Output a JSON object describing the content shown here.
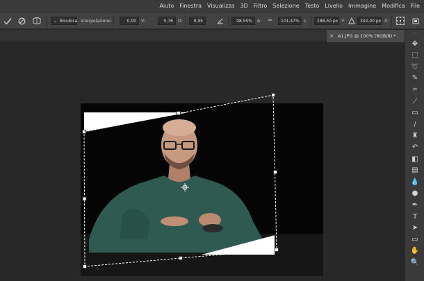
{
  "menu": {
    "items": [
      "File",
      "Modifica",
      "Immagine",
      "Livello",
      "Testo",
      "Selezione",
      "Filtro",
      "3D",
      "Visualizza",
      "Finestra",
      "Aiuto"
    ]
  },
  "options": {
    "x_label": "X:",
    "x_value": "302,00 px",
    "y_label": "Y:",
    "y_value": "188,50 px",
    "l_label": "L:",
    "l_value": "101,47%",
    "a_label": "A:",
    "a_value": "98,55%",
    "angle_value": "9,95",
    "o_label": "O:",
    "o_value": "5,76",
    "v_label": "V:",
    "v_value": "0,00",
    "interp_label": "Interpolazione:",
    "interp_value": "Bicubica"
  },
  "document": {
    "tab_label": "A1.JPG @ 100% (RGB/8) *",
    "close_label": "×"
  },
  "colors": {
    "menubar": "#3a3a3a",
    "optionsbar": "#424242",
    "canvas": "#282828",
    "toolbar": "#3a3a3a",
    "sweater": "#2e5a52"
  },
  "tools": [
    "move-tool-icon",
    "rectangular-marquee-icon",
    "lasso-icon",
    "quick-selection-icon",
    "crop-icon",
    "eyedropper-icon",
    "healing-brush-icon",
    "brush-icon",
    "clone-stamp-icon",
    "history-brush-icon",
    "eraser-icon",
    "gradient-icon",
    "blur-icon",
    "dodge-icon",
    "pen-icon",
    "type-icon",
    "path-selection-icon",
    "rectangle-shape-icon",
    "hand-icon",
    "zoom-icon"
  ]
}
